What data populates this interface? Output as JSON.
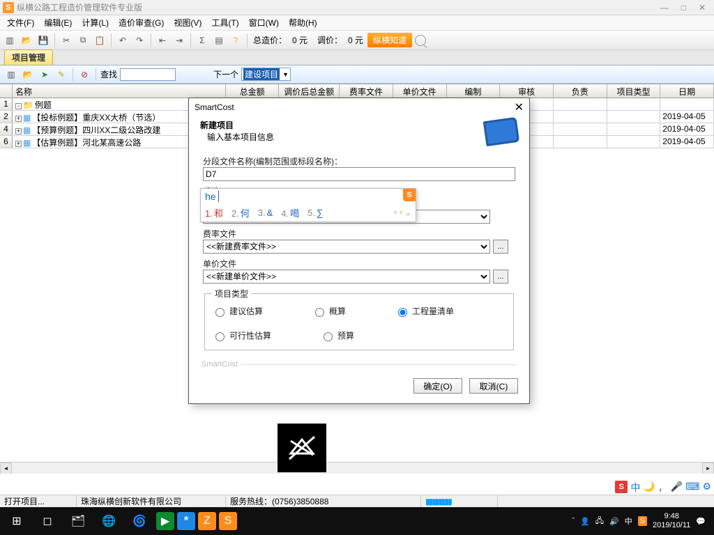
{
  "app": {
    "title": "纵横公路工程造价管理软件专业版"
  },
  "menus": [
    "文件(F)",
    "编辑(E)",
    "计算(L)",
    "造价审查(G)",
    "视图(V)",
    "工具(T)",
    "窗口(W)",
    "帮助(H)"
  ],
  "toolbar": {
    "total_label": "总造价：",
    "total_value": "0 元",
    "adj_label": "调价：",
    "adj_value": "0 元",
    "zh_btn": "纵横知道"
  },
  "tab": {
    "active": "项目管理"
  },
  "subbar": {
    "find_label": "查找",
    "next_label": "下一个",
    "filter_selected": "建设项目"
  },
  "grid": {
    "headers": [
      "",
      "名称",
      "总金额",
      "调价后总金额",
      "费率文件",
      "单价文件",
      "编制",
      "审核",
      "负责",
      "项目类型",
      "日期"
    ],
    "rows": [
      {
        "n": "1",
        "name": "例题",
        "indent": 0,
        "type": "folder",
        "exp": "-",
        "date": ""
      },
      {
        "n": "2",
        "name": "【投标例题】重庆XX大桥（节选）",
        "indent": 1,
        "type": "doc",
        "exp": "+",
        "date": "2019-04-05"
      },
      {
        "n": "4",
        "name": "【预算例题】四川XX二级公路改建",
        "indent": 1,
        "type": "doc",
        "exp": "+",
        "date": "2019-04-05"
      },
      {
        "n": "6",
        "name": "【估算例题】河北某高速公路",
        "indent": 1,
        "type": "doc",
        "exp": "+",
        "date": "2019-04-05"
      }
    ]
  },
  "modal": {
    "title": "SmartCost",
    "heading": "新建项目",
    "sub": "输入基本项目信息",
    "seg_label": "分段文件名称(编制范围或标段名称)：",
    "seg_value": "D7",
    "sel_label": "请选",
    "fee_label": "费率文件",
    "fee_value": "<<新建费率文件>>",
    "price_label": "单价文件",
    "price_value": "<<新建单价文件>>",
    "ptype_legend": "项目类型",
    "radios": [
      "建议估算",
      "概算",
      "工程量清单",
      "可行性估算",
      "预算"
    ],
    "radio_selected": 2,
    "smartcost_lbl": "SmartCost",
    "ok": "确定(O)",
    "cancel": "取消(C)"
  },
  "ime": {
    "input": "he",
    "candidates": [
      {
        "n": "1",
        "w": "和"
      },
      {
        "n": "2",
        "w": "何"
      },
      {
        "n": "3",
        "w": "&"
      },
      {
        "n": "4",
        "w": "喝"
      },
      {
        "n": "5",
        "w": "∑"
      }
    ]
  },
  "status": {
    "open": "打开项目...",
    "company": "珠海纵横创新软件有限公司",
    "hotline_lbl": "服务热线：",
    "hotline": "(0756)3850888"
  },
  "tray": {
    "lang": "中",
    "time": "9:48",
    "date": "2019/10/11"
  }
}
